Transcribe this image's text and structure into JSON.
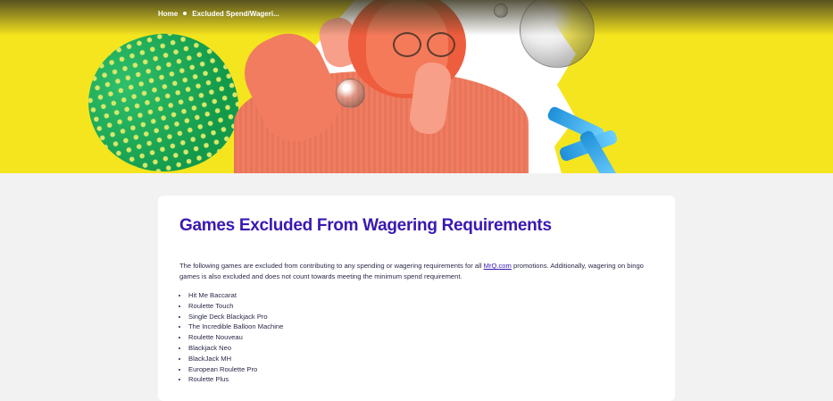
{
  "breadcrumb": {
    "home": "Home",
    "current": "Excluded Spend/Wageri..."
  },
  "colors": {
    "hero_background": "#f5e51e",
    "heading": "#3a18b3",
    "page_background": "#f2f2f2"
  },
  "content": {
    "title": "Games Excluded From Wagering Requirements",
    "intro_before": "The following games are excluded from contributing to any spending or wagering requirements for all ",
    "intro_link": "MrQ.com",
    "intro_after": " promotions. Additionally, wagering on bingo games is also excluded and does not count towards meeting the minimum spend requirement.",
    "games": [
      "Hit Me Baccarat",
      "Roulette Touch",
      "Single Deck Blackjack Pro",
      "The Incredible Balloon Machine",
      "Roulette Nouveau",
      "Blackjack Neo",
      "BlackJack MH",
      "European Roulette Pro",
      "Roulette Plus"
    ]
  }
}
